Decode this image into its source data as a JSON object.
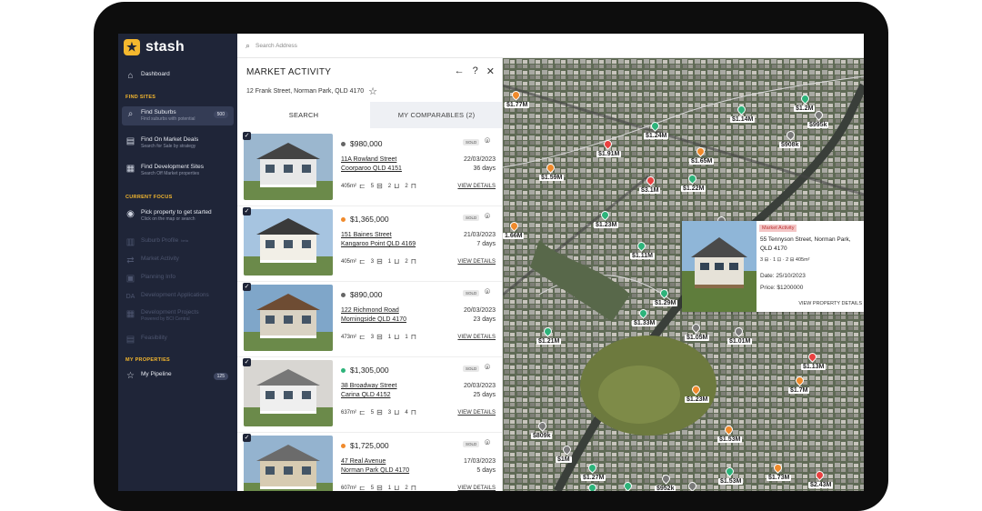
{
  "app": {
    "name": "stash"
  },
  "sidebar": {
    "dashboard": "Dashboard",
    "find_sites_heading": "FIND SITES",
    "find_suburbs": {
      "label": "Find Suburbs",
      "sub": "Find suburbs with potential",
      "badge": "500"
    },
    "on_market": {
      "label": "Find On Market Deals",
      "sub": "Search for Sale by strategy"
    },
    "development": {
      "label": "Find Development Sites",
      "sub": "Search Off Market properties"
    },
    "current_focus_heading": "CURRENT FOCUS",
    "pick_property": {
      "label": "Pick property to get started",
      "sub": "Click on the map or search"
    },
    "suburb_profile": "Suburb Profile",
    "suburb_profile_tag": "beta",
    "market_activity": "Market Activity",
    "planning_info": "Planning Info",
    "dev_applications": "Development Applications",
    "dev_projects": {
      "label": "Development Projects",
      "sub": "Powered by BCI Central"
    },
    "feasibility": "Feasibility",
    "my_properties_heading": "MY PROPERTIES",
    "my_pipeline": {
      "label": "My Pipeline",
      "badge": "125"
    }
  },
  "search": {
    "placeholder": "Search Address"
  },
  "panel": {
    "title": "MARKET ACTIVITY",
    "address": "12 Frank Street, Norman Park, QLD 4170",
    "tabs": [
      "SEARCH",
      "MY COMPARABLES (2)"
    ],
    "listings": [
      {
        "price": "$980,000",
        "dot": "#666666",
        "status": "SOLD",
        "street": "11A Rowland Street",
        "suburb": "Coorparoo QLD 4151",
        "date": "22/03/2023",
        "days": "36 days",
        "area": "405m²",
        "beds": "5",
        "baths": "2",
        "cars": "2",
        "link": "VIEW DETAILS"
      },
      {
        "price": "$1,365,000",
        "dot": "#f08a2c",
        "status": "SOLD",
        "street": "151 Baines Street",
        "suburb": "Kangaroo Point QLD 4169",
        "date": "21/03/2023",
        "days": "7 days",
        "area": "405m²",
        "beds": "3",
        "baths": "1",
        "cars": "2",
        "link": "VIEW DETAILS"
      },
      {
        "price": "$890,000",
        "dot": "#666666",
        "status": "SOLD",
        "street": "122 Richmond Road",
        "suburb": "Morningside QLD 4170",
        "date": "20/03/2023",
        "days": "23 days",
        "area": "473m²",
        "beds": "3",
        "baths": "1",
        "cars": "1",
        "link": "VIEW DETAILS"
      },
      {
        "price": "$1,305,000",
        "dot": "#2db37a",
        "status": "SOLD",
        "street": "38 Broadway Street",
        "suburb": "Carina QLD 4152",
        "date": "20/03/2023",
        "days": "25 days",
        "area": "637m²",
        "beds": "5",
        "baths": "3",
        "cars": "4",
        "link": "VIEW DETAILS"
      },
      {
        "price": "$1,725,000",
        "dot": "#f08a2c",
        "status": "SOLD",
        "street": "47 Real Avenue",
        "suburb": "Norman Park QLD 4170",
        "date": "17/03/2023",
        "days": "5 days",
        "area": "607m²",
        "beds": "5",
        "baths": "1",
        "cars": "2",
        "link": "VIEW DETAILS"
      }
    ]
  },
  "map": {
    "labels": [
      {
        "text": "$1.77M",
        "color": "#f08a2c"
      },
      {
        "text": "$1.14M",
        "color": "#2db37a"
      },
      {
        "text": "$1.2M",
        "color": "#2db37a"
      },
      {
        "text": "$995k",
        "color": "#7a7a7a"
      },
      {
        "text": "$1.24M",
        "color": "#2db37a"
      },
      {
        "text": "$908k",
        "color": "#7a7a7a"
      },
      {
        "text": "$1.91M",
        "color": "#e94040"
      },
      {
        "text": "$1.65M",
        "color": "#f08a2c"
      },
      {
        "text": "$1.59M",
        "color": "#f08a2c"
      },
      {
        "text": "$1.22M",
        "color": "#2db37a"
      },
      {
        "text": "$3.1M",
        "color": "#e94040"
      },
      {
        "text": "$1.23M",
        "color": "#2db37a"
      },
      {
        "text": "$940k",
        "color": "#7a7a7a"
      },
      {
        "text": "1.66M",
        "color": "#f08a2c"
      },
      {
        "text": "$1.11M",
        "color": "#2db37a"
      },
      {
        "text": "$1.29M",
        "color": "#2db37a"
      },
      {
        "text": "$1.33M",
        "color": "#2db37a"
      },
      {
        "text": "$1.21M",
        "color": "#2db37a"
      },
      {
        "text": "$1.05M",
        "color": "#7a7a7a"
      },
      {
        "text": "$1.01M",
        "color": "#7a7a7a"
      },
      {
        "text": "$1.13M",
        "color": "#e94040"
      },
      {
        "text": "$1.7M",
        "color": "#f08a2c"
      },
      {
        "text": "$1.23M",
        "color": "#f08a2c"
      },
      {
        "text": "$809k",
        "color": "#7a7a7a"
      },
      {
        "text": "$1.53M",
        "color": "#f08a2c"
      },
      {
        "text": "$1M",
        "color": "#7a7a7a"
      },
      {
        "text": "$1.27M",
        "color": "#2db37a"
      },
      {
        "text": "$952k",
        "color": "#7a7a7a"
      },
      {
        "text": "$1.73M",
        "color": "#f08a2c"
      },
      {
        "text": "$1.53M",
        "color": "#2db37a"
      },
      {
        "text": "$2.43M",
        "color": "#e94040"
      },
      {
        "text": "$1.13M",
        "color": "#2db37a"
      },
      {
        "text": "$1.11M",
        "color": "#2db37a"
      },
      {
        "text": "$970k",
        "color": "#7a7a7a"
      },
      {
        "text": "$1.62M",
        "color": "#f08a2c"
      },
      {
        "text": "$2.5M",
        "color": "#e94040"
      }
    ],
    "popup": {
      "tag": "Market Activity",
      "address": "55 Tennyson Street, Norman Park, QLD 4170",
      "features": "3 ⊟ · 1 ⊡ · 2 ⊟   405m²",
      "date": "Date: 25/10/2023",
      "price": "Price: $1200000",
      "link": "VIEW PROPERTY DETAILS"
    }
  }
}
